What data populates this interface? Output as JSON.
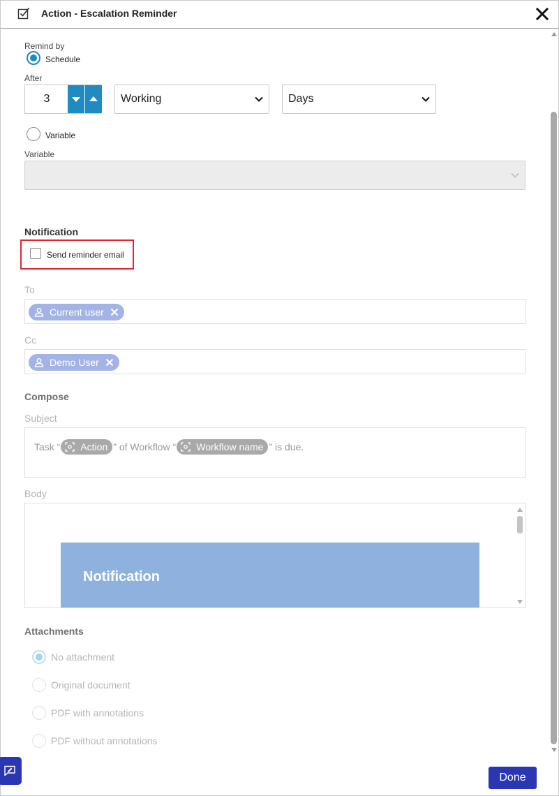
{
  "header": {
    "title": "Action - Escalation Reminder",
    "icon": "checkbox-edit-icon",
    "close_icon": "close-icon"
  },
  "remind": {
    "label": "Remind by",
    "schedule_label": "Schedule",
    "schedule_selected": true,
    "after_label": "After",
    "after_value": "3",
    "mode_value": "Working",
    "unit_value": "Days",
    "variable_radio_label": "Variable",
    "variable_selected": false,
    "variable_field_label": "Variable",
    "variable_value": ""
  },
  "notification": {
    "title": "Notification",
    "send_email_label": "Send reminder email",
    "send_email_checked": false
  },
  "recipients": {
    "to_label": "To",
    "to_chips": [
      "Current user"
    ],
    "cc_label": "Cc",
    "cc_chips": [
      "Demo User"
    ]
  },
  "compose": {
    "title": "Compose",
    "subject_label": "Subject",
    "subject_text_1": "Task “",
    "subject_var_1": "Action",
    "subject_text_2": "” of Workflow “",
    "subject_var_2": "Workflow name",
    "subject_text_3": "” is due.",
    "body_label": "Body",
    "body_banner": "Notification"
  },
  "attachments": {
    "title": "Attachments",
    "options": [
      "No attachment",
      "Original document",
      "PDF with annotations",
      "PDF without annotations"
    ],
    "selected": "No attachment"
  },
  "footer": {
    "done_label": "Done",
    "feedback_icon": "feedback-icon"
  },
  "colors": {
    "accent": "#1e8bc3",
    "primary_button": "#2a36b3",
    "highlight": "#e0262b",
    "chip": "#a3b3e6",
    "var_chip": "#a9a9a9",
    "banner": "#8fb1de"
  }
}
